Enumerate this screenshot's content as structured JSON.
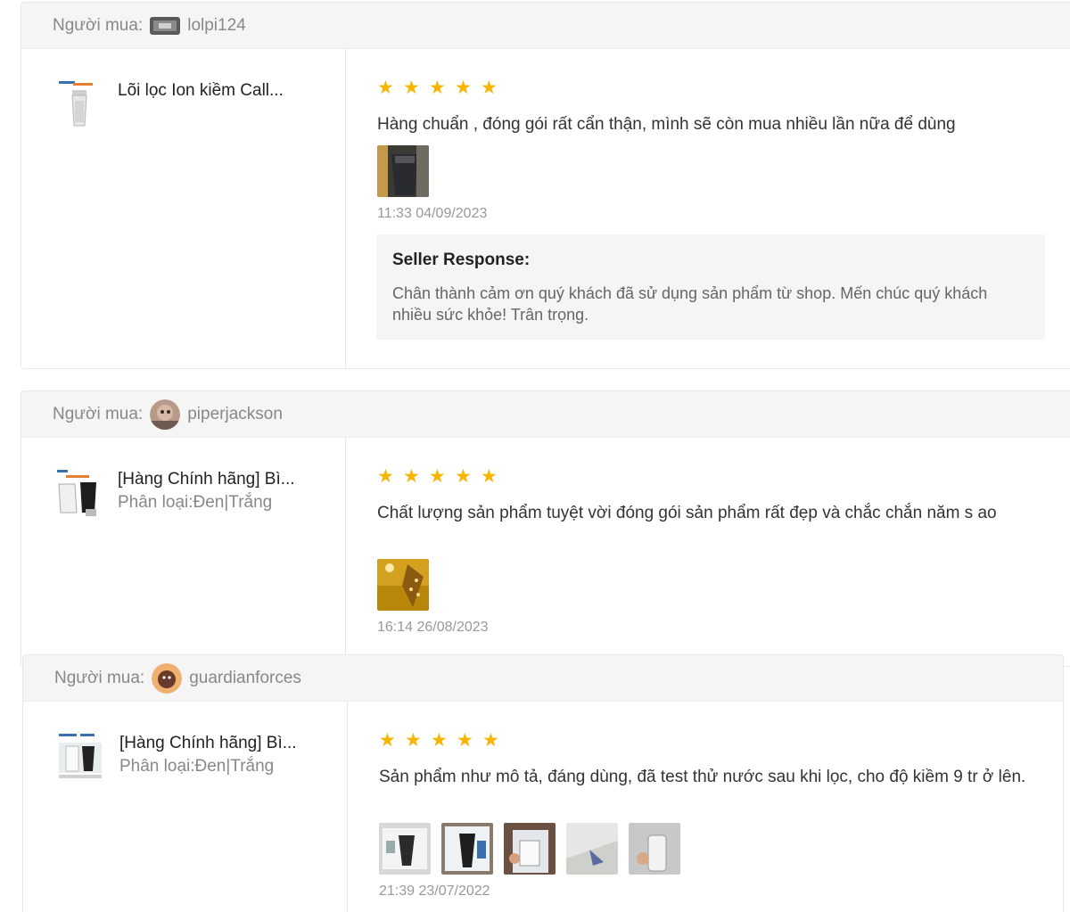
{
  "buyer_label": "Người mua:",
  "reviews": [
    {
      "username": "lolpi124",
      "product_name": "Lõi lọc Ion kiềm Call...",
      "variant": "",
      "stars": 5,
      "text": "Hàng chuẩn , đóng gói rất cẩn thận, mình sẽ còn mua nhiều lần nữa để dùng",
      "time": "11:33 04/09/2023",
      "seller_response": {
        "title": "Seller Response:",
        "text": "Chân thành cảm ơn quý khách đã sử dụng sản phẩm từ shop. Mến chúc quý khách nhiều sức khỏe! Trân trọng."
      }
    },
    {
      "username": "piperjackson",
      "product_name": "[Hàng Chính hãng] Bì...",
      "variant": "Phân loại:Đen|Trắng",
      "stars": 5,
      "text": "Chất lượng sản phẩm tuyệt vời đóng gói sản phẩm rất đẹp và chắc chắn năm s ao",
      "time": "16:14 26/08/2023"
    },
    {
      "username": "guardianforces",
      "product_name": "[Hàng Chính hãng] Bì...",
      "variant": "Phân loại:Đen|Trắng",
      "stars": 5,
      "text": "Sản phẩm như mô tả, đáng dùng, đã test thử nước sau khi lọc, cho độ kiềm 9 tr ở lên.",
      "time": "21:39 23/07/2022"
    }
  ],
  "colors": {
    "star": "#f7b500",
    "header_bg": "#f5f5f5",
    "muted": "#888888"
  }
}
